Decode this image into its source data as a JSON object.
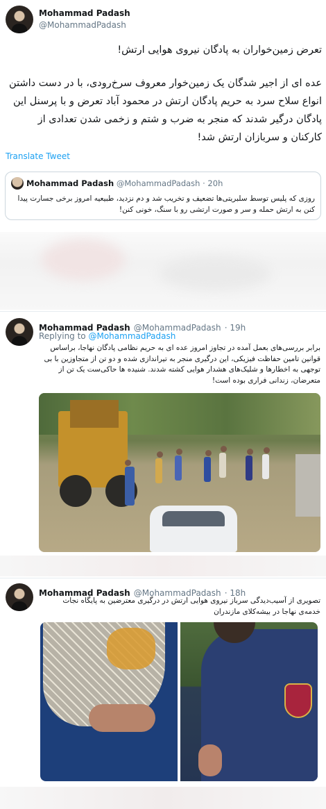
{
  "tweet1": {
    "name": "Mohammad Padash",
    "handle": "@MohammadPadash",
    "title": "تعرض زمین‌خواران به پادگان نیروی هوایی ارتش!",
    "body": "عده ای از اجیر شدگان یک زمین‌خوار معروف سرخ‌رودی، با در دست داشتن انواع سلاح سرد به حریم پادگان ارتش در محمود آباد تعرض و با پرسنل این پادگان درگیر شدند که منجر به ضرب و شتم و زخمی شدن تعدادی از کارکنان و سربازان ارتش شد!",
    "translate": "Translate Tweet",
    "quote": {
      "name": "Mohammad Padash",
      "handle": "@MohammadPadash",
      "time": "· 20h",
      "text": "روزی که پلیس توسط سلبریتی‌ها تضعیف و تخریب شد و دم نزدید، طبیعیه امروز برخی جسارت پیدا کنن به ارتش حمله و سر و صورت ارتشی رو با سنگ، خونی کنن!"
    }
  },
  "tweet2": {
    "name": "Mohammad Padash",
    "handle": "@MohammadPadash",
    "time": "· 19h",
    "replying_prefix": "Replying to",
    "replying_handle": "@MohammadPadash",
    "text": "برابر بررسی‌های بعمل آمده در تجاوز امروز عده ای به حریم نظامی پادگان نهاجا، براساس قوانین تامین حفاظت فیزیکی، این درگیری منجر به تیراندازی شده و دو تن از متجاوزین با بی توجهی به اخطارها و شلیک‌های هشدار هوایی کشته شدند. شنیده ها حاکی‌ست یک تن از متعرضان، زندانی فراری بوده است!"
  },
  "tweet3": {
    "name": "Mohammad Padash",
    "handle": "@MohammadPadash",
    "time": "· 18h",
    "text": "تصویری از آسیب‌دیدگی سرباز نیروی هوایی ارتش در درگیری معترضین به پایگاه نجات خدمه‌ی نهاجا در بیشه‌کلای مازندران"
  }
}
